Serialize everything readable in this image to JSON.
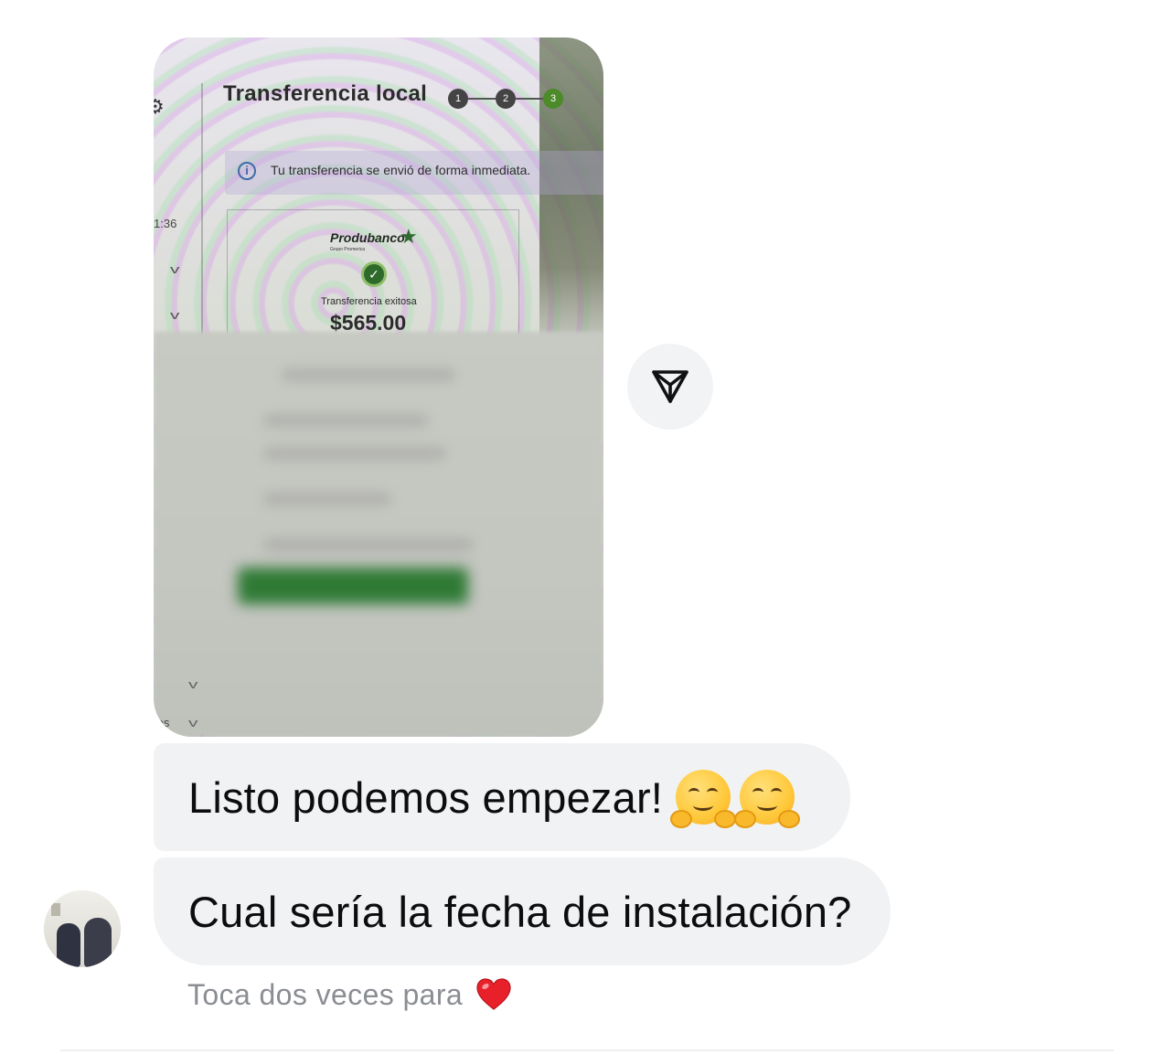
{
  "shared_image": {
    "screen_title": "Transferencia local",
    "steps": [
      "1",
      "2",
      "3"
    ],
    "info_text": "Tu transferencia se envió de forma inmediata.",
    "side_time": "1:36",
    "side_footer": "tos",
    "bank_name": "Produbanco",
    "bank_subtitle": "Grupo Promerica",
    "status_label": "Transferencia exitosa",
    "amount": "$565.00"
  },
  "messages": [
    {
      "text": "Listo podemos empezar!",
      "emojis": [
        "hugging-face-icon",
        "hugging-face-icon"
      ]
    },
    {
      "text": "Cual sería la fecha de instalación?"
    }
  ],
  "hint": {
    "text": "Toca dos veces para",
    "icon": "heart-icon",
    "heart_color": "#e8202a"
  },
  "colors": {
    "bubble_bg": "#f1f2f4",
    "text": "#0d0d0d",
    "hint_text": "#8a8d92",
    "accent_green": "#4c8a2a"
  }
}
